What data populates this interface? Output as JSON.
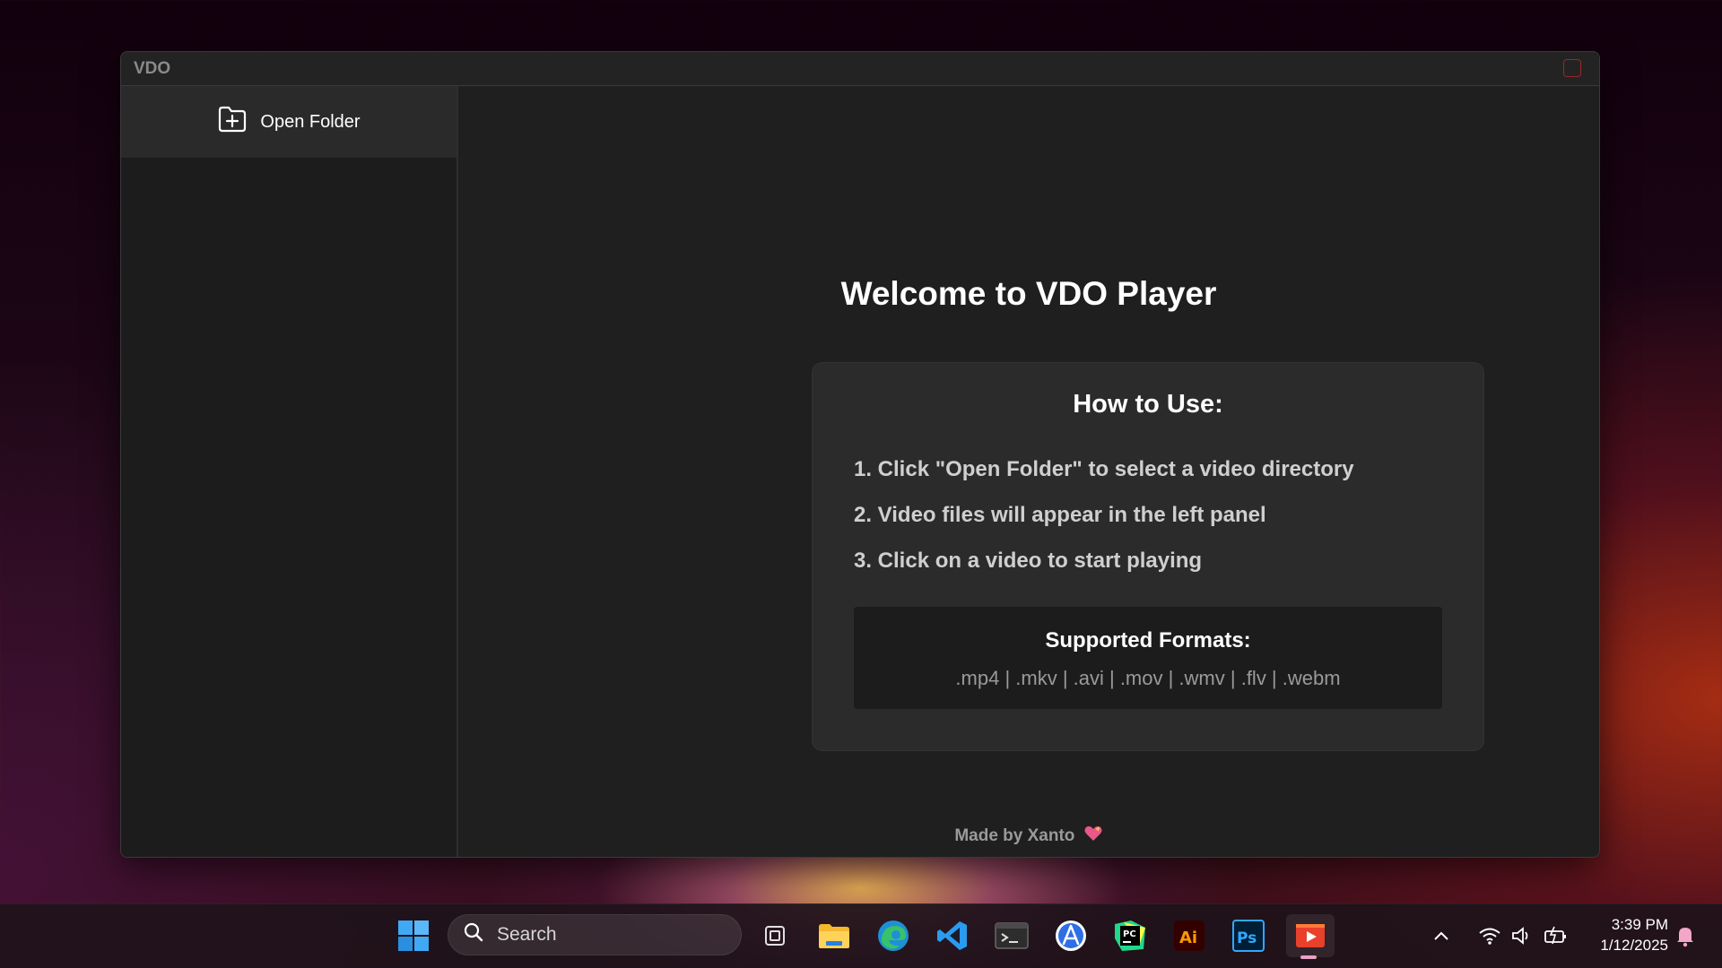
{
  "window": {
    "title": "VDO"
  },
  "sidebar": {
    "open_folder_label": "Open Folder"
  },
  "main": {
    "welcome_title": "Welcome to VDO Player",
    "how_to_title": "How to Use:",
    "steps": [
      "1. Click \"Open Folder\" to select a video directory",
      "2. Video files will appear in the left panel",
      "3. Click on a video to start playing"
    ],
    "formats_title": "Supported Formats:",
    "formats_list": ".mp4 | .mkv | .avi | .mov | .wmv | .flv | .webm",
    "credit": "Made by Xanto"
  },
  "taskbar": {
    "search_placeholder": "Search",
    "apps": [
      "start-icon",
      "search-icon",
      "task-view-icon",
      "file-explorer-icon",
      "edge-icon",
      "vscode-icon",
      "terminal-icon",
      "app-store-icon",
      "pycharm-icon",
      "illustrator-icon",
      "photoshop-icon",
      "vdo-player-icon"
    ],
    "illustrator_label": "Ai",
    "photoshop_label": "Ps",
    "pycharm_label": "PC",
    "clock_time": "3:39 PM",
    "clock_date": "1/12/2025"
  },
  "colors": {
    "window_bg": "#1c1c1c",
    "card_bg": "#2b2b2b",
    "accent_close": "#9a2828",
    "heart": "#e8588b"
  }
}
